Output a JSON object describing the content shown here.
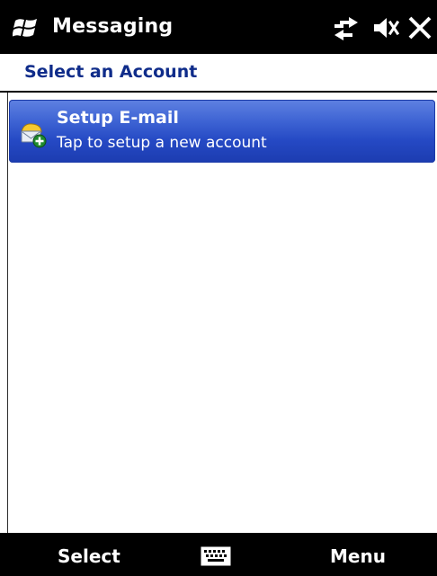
{
  "titlebar": {
    "app_title": "Messaging",
    "start_icon": "windows-flag-icon",
    "status_icons": [
      "connectivity-icon",
      "volume-muted-icon",
      "close-icon"
    ]
  },
  "header": {
    "title": "Select an Account"
  },
  "accounts": [
    {
      "title": "Setup E-mail",
      "subtitle": "Tap to setup a new account",
      "icon": "add-email-account-icon",
      "selected": true
    }
  ],
  "softkeys": {
    "left_label": "Select",
    "right_label": "Menu",
    "center_icon": "keyboard-icon"
  },
  "colors": {
    "header_title": "#0f2c8a",
    "selection_top": "#5f81e2",
    "selection_bottom": "#1c3cb0",
    "bars": "#000000"
  }
}
